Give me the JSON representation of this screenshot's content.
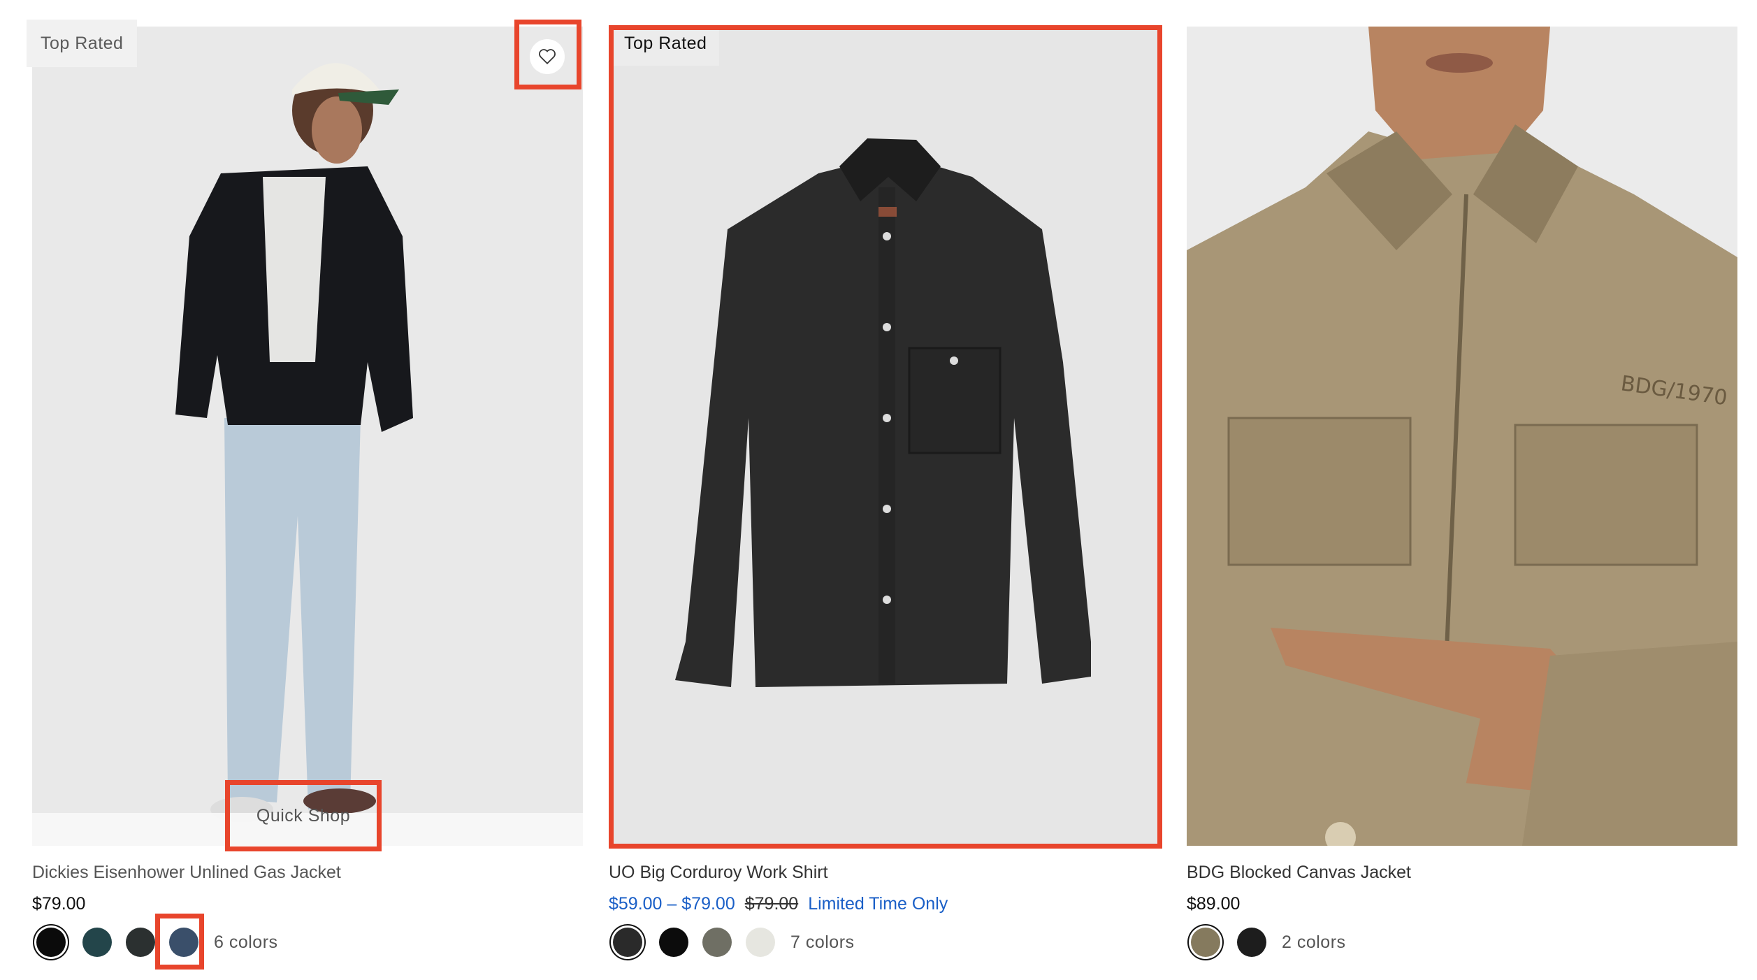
{
  "products": [
    {
      "badge": "Top Rated",
      "name": "Dickies Eisenhower Unlined Gas Jacket",
      "price": "$79.00",
      "quick_shop": "Quick Shop",
      "colors_label": "6 colors",
      "swatches": [
        "#0b0b0b",
        "#23454a",
        "#2b3030",
        "#3a4f6a"
      ]
    },
    {
      "badge": "Top Rated",
      "name": "UO Big Corduroy Work Shirt",
      "sale_price": "$59.00 – $79.00",
      "original_price": "$79.00",
      "promo": "Limited Time Only",
      "colors_label": "7 colors",
      "swatches": [
        "#2a2a2a",
        "#0c0c0c",
        "#6f6f64",
        "#e6e6e0"
      ]
    },
    {
      "name": "BDG Blocked Canvas Jacket",
      "price": "$89.00",
      "colors_label": "2 colors",
      "swatches": [
        "#857a5e",
        "#1d1d1d"
      ]
    }
  ],
  "colors": {
    "highlight": "#e8452c",
    "sale": "#1a5fc7"
  }
}
